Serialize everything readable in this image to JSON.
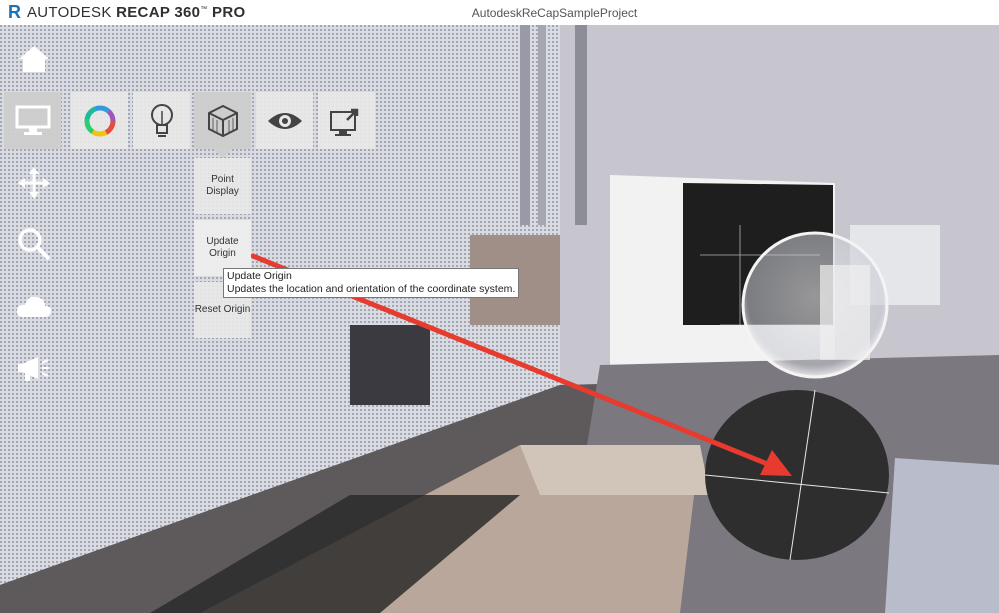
{
  "app": {
    "brand_primary": "AUTODESK",
    "brand_product": "RECAP 360",
    "brand_tm": "™",
    "brand_edition": "PRO",
    "logo_letter": "R",
    "project_name": "AutodeskReCapSampleProject"
  },
  "left_toolbar": {
    "icons": [
      "home-icon",
      "monitor-icon",
      "move-icon",
      "search-icon",
      "cloud-icon",
      "megaphone-icon"
    ]
  },
  "top_toolbar": {
    "icons": [
      "color-wheel-icon",
      "lightbulb-icon",
      "cube-icon",
      "eye-icon",
      "export-icon"
    ]
  },
  "submenu": {
    "point_display": "Point Display",
    "update_origin": "Update Origin",
    "reset_origin": "Reset Origin"
  },
  "tooltip": {
    "title": "Update Origin",
    "description": "Updates the location and orientation of the coordinate system."
  },
  "colors": {
    "accent_arrow": "#e63b2e",
    "logo_blue": "#1c72b8"
  }
}
